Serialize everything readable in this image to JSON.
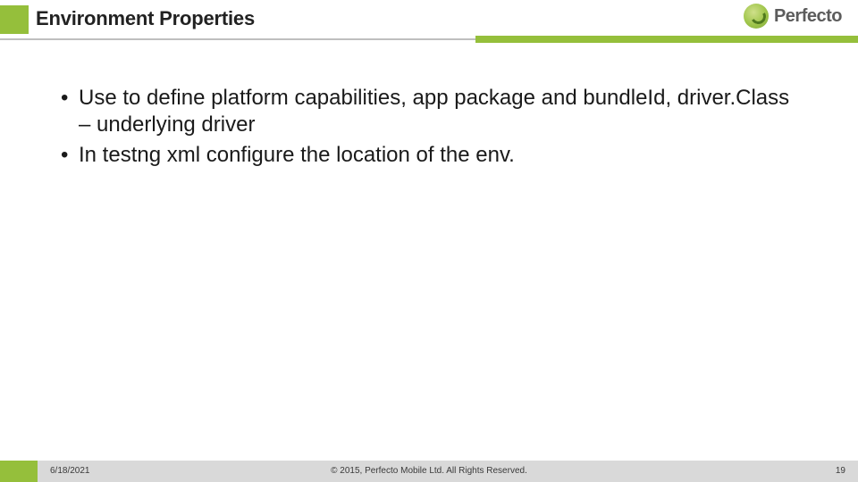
{
  "header": {
    "title": "Environment Properties",
    "logo_text": "Perfecto"
  },
  "bullets": [
    "Use to define platform capabilities, app package and bundleId, driver.Class – underlying driver",
    "In testng xml configure the location of the env."
  ],
  "footer": {
    "date": "6/18/2021",
    "copyright": "© 2015, Perfecto Mobile Ltd.  All Rights Reserved.",
    "page": "19"
  },
  "colors": {
    "accent_green": "#95bf3b",
    "footer_grey": "#d9d9d9",
    "rule_grey": "#bfbfbf"
  }
}
